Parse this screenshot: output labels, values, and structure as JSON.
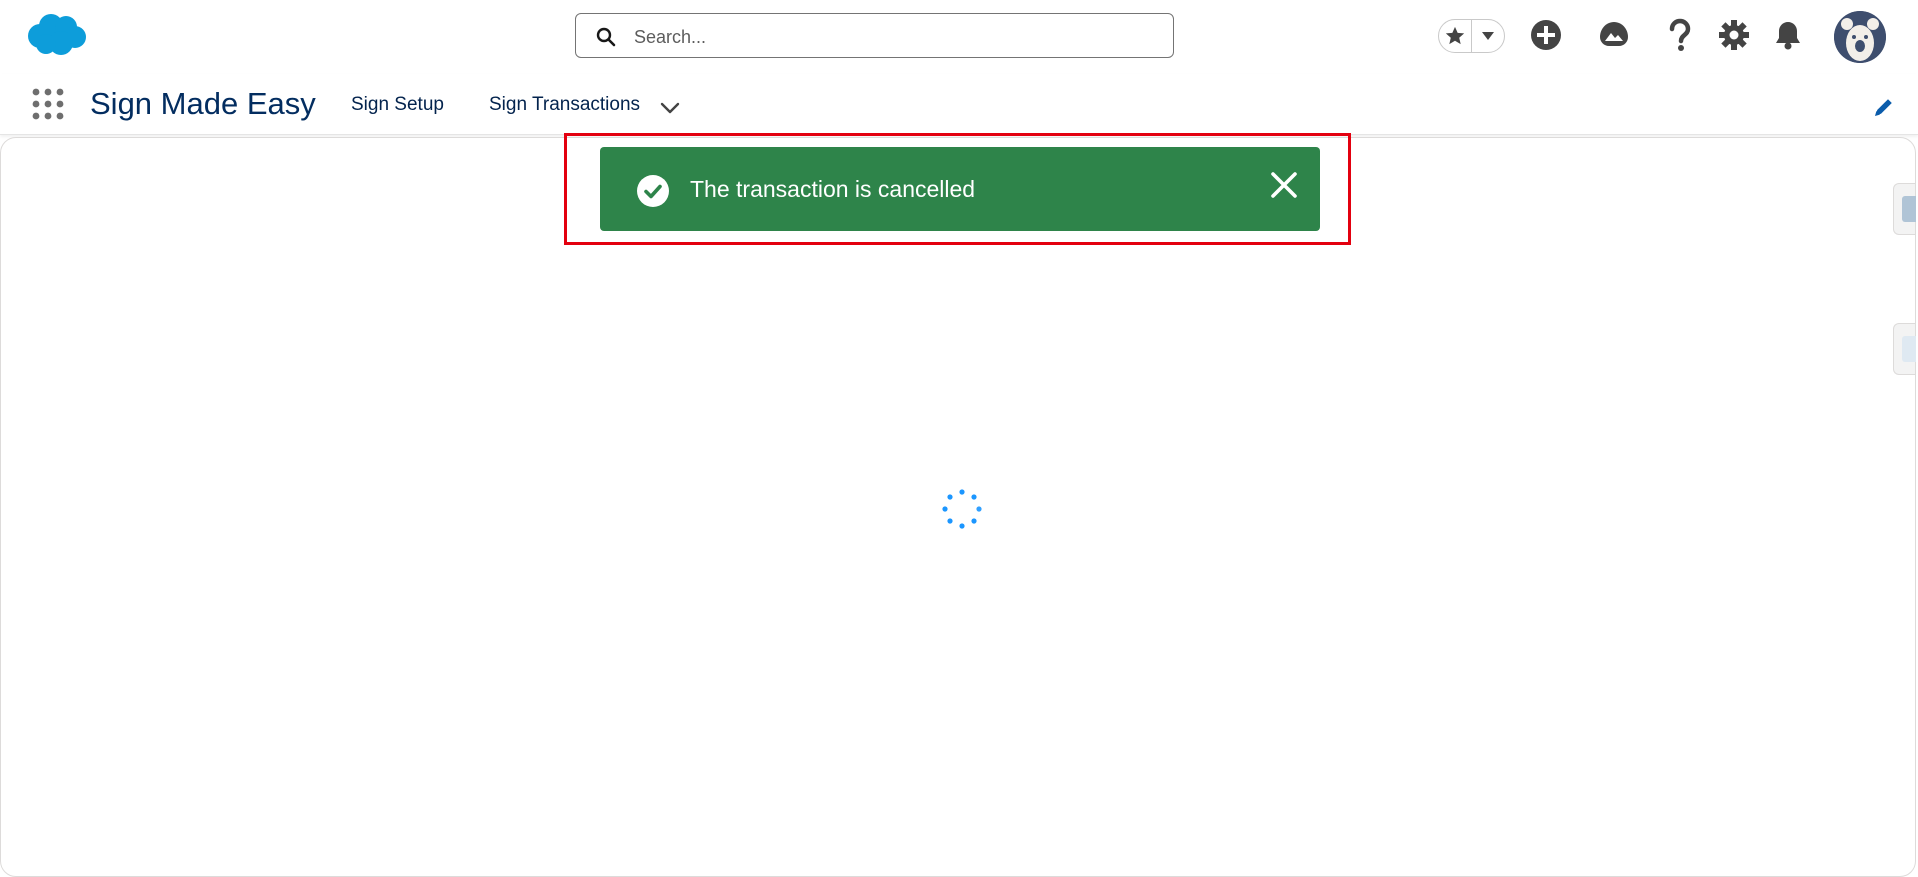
{
  "colors": {
    "brand": "#0d9dda",
    "app_name": "#032d60",
    "toast_success": "#2e844a",
    "highlight": "#e3000f",
    "spinner": "#1b96ff"
  },
  "header": {
    "logo_icon": "salesforce-cloud-icon",
    "search": {
      "placeholder": "Search..."
    },
    "icons": [
      "favorites-star-icon",
      "favorites-dropdown-icon",
      "add-icon",
      "trailhead-guidance-icon",
      "help-icon",
      "setup-gear-icon",
      "notifications-bell-icon",
      "user-avatar"
    ]
  },
  "nav": {
    "app_launcher_icon": "app-launcher-icon",
    "app_name": "Sign Made Easy",
    "items": [
      {
        "label": "Sign Setup"
      },
      {
        "label": "Sign Transactions"
      }
    ],
    "edit_icon": "pencil-icon"
  },
  "toast": {
    "message": "The transaction is cancelled",
    "variant": "success",
    "icon": "success-check-icon",
    "close_icon": "close-icon"
  },
  "main": {
    "state": "loading",
    "spinner_icon": "loading-spinner"
  }
}
